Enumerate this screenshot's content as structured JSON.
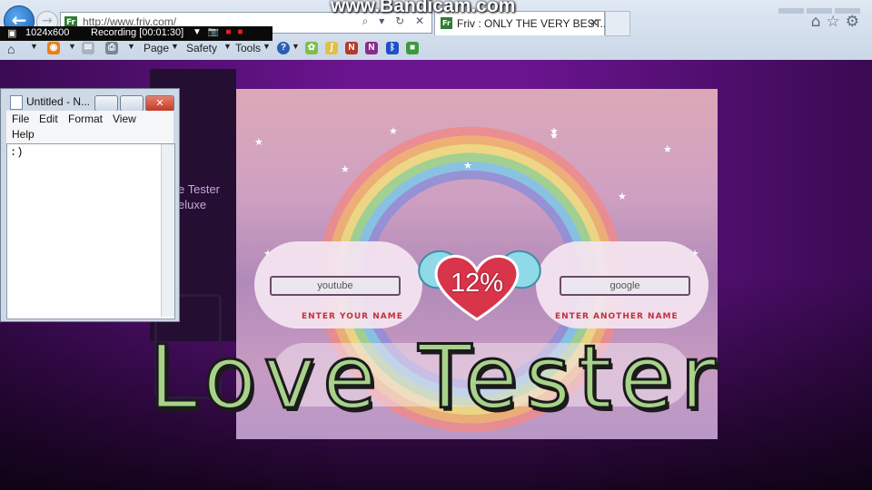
{
  "watermark": "www.Bandicam.com",
  "recording": {
    "resolution": "1024x600",
    "status": "Recording [00:01:30]"
  },
  "browser": {
    "url": "http://www.friv.com/",
    "tab_title": "Friv : ONLY THE VERY BEST...",
    "tab_close": "✕",
    "commands": {
      "page": "Page",
      "safety": "Safety",
      "tools": "Tools",
      "help": "?"
    }
  },
  "notepad": {
    "title": "Untitled - N...",
    "menu": {
      "file": "File",
      "edit": "Edit",
      "format": "Format",
      "view": "View",
      "help": "Help"
    },
    "content": ":)"
  },
  "friv_sidebar": {
    "title_line1": "e Tester",
    "title_line2": "eluxe"
  },
  "game": {
    "name1": "youtube",
    "name2": "google",
    "label1": "ENTER YOUR NAME",
    "label2": "ENTER ANOTHER NAME",
    "percentage": "12%"
  },
  "overlay_title": "Love Tester",
  "colors": {
    "page_bg": "#6a148f",
    "title_fill": "#a8d28a",
    "heart": "#d8344a"
  }
}
